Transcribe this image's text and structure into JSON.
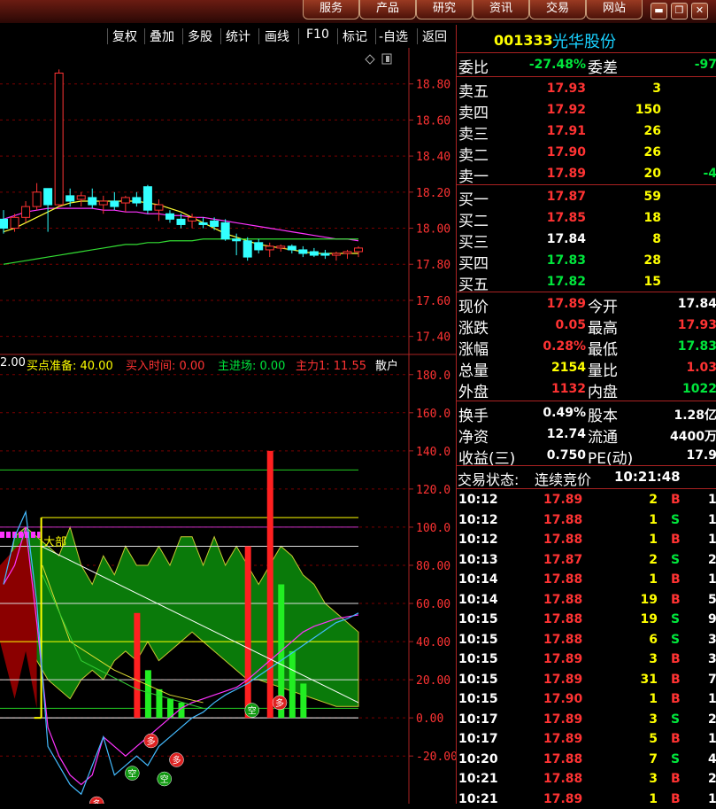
{
  "nav": {
    "buttons": [
      "服务",
      "产品",
      "研究",
      "资讯",
      "交易",
      "网站"
    ],
    "window_buttons": {
      "minimize": "▬",
      "restore": "❐",
      "close": "✕"
    }
  },
  "toolbar": {
    "items": [
      "复权",
      "叠加",
      "多股",
      "统计",
      "画线",
      "F10",
      "标记",
      "-自选",
      "返回"
    ]
  },
  "stock": {
    "code": "001333",
    "name": "光华股份"
  },
  "order_ratio": {
    "label1": "委比",
    "value1": "-27.48%",
    "label2": "委差",
    "value2": "-97"
  },
  "asks": [
    {
      "label": "卖五",
      "price": "17.93",
      "vol": "3",
      "extra": ""
    },
    {
      "label": "卖四",
      "price": "17.92",
      "vol": "150",
      "extra": ""
    },
    {
      "label": "卖三",
      "price": "17.91",
      "vol": "26",
      "extra": ""
    },
    {
      "label": "卖二",
      "price": "17.90",
      "vol": "26",
      "extra": ""
    },
    {
      "label": "卖一",
      "price": "17.89",
      "vol": "20",
      "extra": "-4"
    }
  ],
  "bids": [
    {
      "label": "买一",
      "price": "17.87",
      "vol": "59"
    },
    {
      "label": "买二",
      "price": "17.85",
      "vol": "18"
    },
    {
      "label": "买三",
      "price": "17.84",
      "vol": "8"
    },
    {
      "label": "买四",
      "price": "17.83",
      "vol": "28"
    },
    {
      "label": "买五",
      "price": "17.82",
      "vol": "15"
    }
  ],
  "quote_rows": [
    {
      "l1": "现价",
      "v1": "17.89",
      "l2": "今开",
      "v2": "17.84"
    },
    {
      "l1": "涨跌",
      "v1": "0.05",
      "l2": "最高",
      "v2": "17.93"
    },
    {
      "l1": "涨幅",
      "v1": "0.28%",
      "l2": "最低",
      "v2": "17.83"
    },
    {
      "l1": "总量",
      "v1": "2154",
      "l2": "量比",
      "v2": "1.03"
    },
    {
      "l1": "外盘",
      "v1": "1132",
      "l2": "内盘",
      "v2": "1022"
    }
  ],
  "stats_rows": [
    {
      "l1": "换手",
      "v1": "0.49%",
      "l2": "股本",
      "v2": "1.28亿"
    },
    {
      "l1": "净资",
      "v1": "12.74",
      "l2": "流通",
      "v2": "4400万"
    },
    {
      "l1": "收益(三)",
      "v1": "0.750",
      "l2": "PE(动)",
      "v2": "17.9"
    }
  ],
  "trade_status": {
    "label": "交易状态:",
    "state": "连续竞价",
    "time": "10:21:48"
  },
  "ticks": [
    {
      "time": "10:12",
      "price": "17.89",
      "vol": "2",
      "side": "B",
      "n": "1"
    },
    {
      "time": "10:12",
      "price": "17.88",
      "vol": "1",
      "side": "S",
      "n": "1"
    },
    {
      "time": "10:12",
      "price": "17.88",
      "vol": "1",
      "side": "B",
      "n": "1"
    },
    {
      "time": "10:13",
      "price": "17.87",
      "vol": "2",
      "side": "S",
      "n": "2"
    },
    {
      "time": "10:14",
      "price": "17.88",
      "vol": "1",
      "side": "B",
      "n": "1"
    },
    {
      "time": "10:14",
      "price": "17.88",
      "vol": "19",
      "side": "B",
      "n": "5"
    },
    {
      "time": "10:15",
      "price": "17.88",
      "vol": "19",
      "side": "S",
      "n": "9"
    },
    {
      "time": "10:15",
      "price": "17.88",
      "vol": "6",
      "side": "S",
      "n": "3"
    },
    {
      "time": "10:15",
      "price": "17.89",
      "vol": "3",
      "side": "B",
      "n": "3"
    },
    {
      "time": "10:15",
      "price": "17.89",
      "vol": "31",
      "side": "B",
      "n": "7"
    },
    {
      "time": "10:15",
      "price": "17.90",
      "vol": "1",
      "side": "B",
      "n": "1"
    },
    {
      "time": "10:17",
      "price": "17.89",
      "vol": "3",
      "side": "S",
      "n": "2"
    },
    {
      "time": "10:17",
      "price": "17.89",
      "vol": "5",
      "side": "B",
      "n": "1"
    },
    {
      "time": "10:20",
      "price": "17.88",
      "vol": "7",
      "side": "S",
      "n": "4"
    },
    {
      "time": "10:21",
      "price": "17.88",
      "vol": "3",
      "side": "B",
      "n": "2"
    },
    {
      "time": "10:21",
      "price": "17.89",
      "vol": "1",
      "side": "B",
      "n": "1"
    }
  ],
  "indicator": {
    "prefix": "2.00",
    "items": [
      {
        "label": "买点准备: 40.00",
        "color": "#ffff00"
      },
      {
        "label": "买入时间: 0.00",
        "color": "#ff3333"
      },
      {
        "label": "主进场: 0.00",
        "color": "#00e63c"
      },
      {
        "label": "主力1: 11.55",
        "color": "#ff3333"
      },
      {
        "label": "散户",
        "color": "#ffffff"
      }
    ],
    "annotation_top": "大部",
    "markers": {
      "duo": "多",
      "kong": "空"
    }
  },
  "price_axis": [
    "18.80",
    "18.60",
    "18.40",
    "18.20",
    "18.00",
    "17.80",
    "17.60",
    "17.40"
  ],
  "ind_axis": [
    "180.0",
    "160.0",
    "140.0",
    "120.0",
    "100.0",
    "80.00",
    "60.00",
    "40.00",
    "20.00",
    "0.00",
    "-20.00"
  ],
  "chart_data": {
    "type": "candlestick+indicator",
    "price_ylim": [
      17.3,
      19.0
    ],
    "indicator_ylim": [
      -45,
      185
    ],
    "ohlc": [
      {
        "o": 18.05,
        "h": 18.1,
        "l": 17.97,
        "c": 18.0
      },
      {
        "o": 18.0,
        "h": 18.08,
        "l": 17.98,
        "c": 18.06
      },
      {
        "o": 18.06,
        "h": 18.15,
        "l": 18.03,
        "c": 18.12
      },
      {
        "o": 18.12,
        "h": 18.25,
        "l": 18.1,
        "c": 18.2
      },
      {
        "o": 18.22,
        "h": 18.22,
        "l": 17.98,
        "c": 18.13
      },
      {
        "o": 18.13,
        "h": 18.88,
        "l": 18.12,
        "c": 18.86
      },
      {
        "o": 18.18,
        "h": 18.22,
        "l": 18.12,
        "c": 18.15
      },
      {
        "o": 18.16,
        "h": 18.2,
        "l": 18.12,
        "c": 18.18
      },
      {
        "o": 18.17,
        "h": 18.22,
        "l": 18.11,
        "c": 18.13
      },
      {
        "o": 18.13,
        "h": 18.18,
        "l": 18.08,
        "c": 18.15
      },
      {
        "o": 18.15,
        "h": 18.2,
        "l": 18.1,
        "c": 18.12
      },
      {
        "o": 18.14,
        "h": 18.18,
        "l": 18.09,
        "c": 18.17
      },
      {
        "o": 18.17,
        "h": 18.2,
        "l": 18.12,
        "c": 18.14
      },
      {
        "o": 18.23,
        "h": 18.24,
        "l": 18.08,
        "c": 18.1
      },
      {
        "o": 18.1,
        "h": 18.16,
        "l": 18.04,
        "c": 18.13
      },
      {
        "o": 18.08,
        "h": 18.1,
        "l": 18.03,
        "c": 18.05
      },
      {
        "o": 18.05,
        "h": 18.08,
        "l": 18.0,
        "c": 18.02
      },
      {
        "o": 18.04,
        "h": 18.08,
        "l": 18.0,
        "c": 18.06
      },
      {
        "o": 18.03,
        "h": 18.06,
        "l": 18.0,
        "c": 18.02
      },
      {
        "o": 18.04,
        "h": 18.06,
        "l": 17.99,
        "c": 18.01
      },
      {
        "o": 18.03,
        "h": 18.05,
        "l": 17.93,
        "c": 17.94
      },
      {
        "o": 17.94,
        "h": 17.97,
        "l": 17.85,
        "c": 17.93
      },
      {
        "o": 17.93,
        "h": 17.95,
        "l": 17.82,
        "c": 17.84
      },
      {
        "o": 17.92,
        "h": 17.94,
        "l": 17.86,
        "c": 17.88
      },
      {
        "o": 17.88,
        "h": 17.92,
        "l": 17.84,
        "c": 17.9
      },
      {
        "o": 17.89,
        "h": 17.91,
        "l": 17.87,
        "c": 17.9
      },
      {
        "o": 17.9,
        "h": 17.91,
        "l": 17.86,
        "c": 17.88
      },
      {
        "o": 17.88,
        "h": 17.9,
        "l": 17.84,
        "c": 17.86
      },
      {
        "o": 17.87,
        "h": 17.89,
        "l": 17.84,
        "c": 17.85
      },
      {
        "o": 17.86,
        "h": 17.88,
        "l": 17.83,
        "c": 17.85
      },
      {
        "o": 17.85,
        "h": 17.87,
        "l": 17.82,
        "c": 17.86
      },
      {
        "o": 17.86,
        "h": 17.88,
        "l": 17.83,
        "c": 17.87
      },
      {
        "o": 17.87,
        "h": 17.9,
        "l": 17.84,
        "c": 17.89
      }
    ],
    "ma_magenta": [
      18.05,
      18.07,
      18.09,
      18.1,
      18.11,
      18.11,
      18.11,
      18.11,
      18.11,
      18.1,
      18.1,
      18.09,
      18.09,
      18.08,
      18.08,
      18.07,
      18.07,
      18.06,
      18.06,
      18.05,
      18.04,
      18.03,
      18.02,
      18.01,
      18.0,
      17.99,
      17.98,
      17.97,
      17.96,
      17.95,
      17.94,
      17.94,
      17.93
    ],
    "ma_yellow": [
      17.98,
      18.0,
      18.03,
      18.06,
      18.09,
      18.12,
      18.14,
      18.15,
      18.15,
      18.15,
      18.15,
      18.15,
      18.15,
      18.14,
      18.13,
      18.11,
      18.09,
      18.06,
      18.03,
      18.0,
      17.97,
      17.95,
      17.93,
      17.91,
      17.9,
      17.89,
      17.88,
      17.87,
      17.86,
      17.86,
      17.86,
      17.86,
      17.86
    ],
    "ma_green": [
      17.8,
      17.81,
      17.82,
      17.83,
      17.84,
      17.85,
      17.86,
      17.87,
      17.88,
      17.89,
      17.9,
      17.91,
      17.91,
      17.92,
      17.92,
      17.93,
      17.93,
      17.93,
      17.94,
      17.94,
      17.94,
      17.94,
      17.94,
      17.94,
      17.94,
      17.94,
      17.94,
      17.94,
      17.94,
      17.94,
      17.94,
      17.94,
      17.94
    ],
    "ind_hlines": [
      130,
      105,
      100,
      90,
      60,
      40,
      20,
      5,
      0
    ],
    "green_band_upper": [
      60,
      95,
      100,
      95,
      90,
      85,
      100,
      80,
      70,
      85,
      75,
      90,
      80,
      80,
      90,
      80,
      95,
      95,
      80,
      95,
      80,
      90,
      80,
      70,
      80,
      90,
      85,
      75,
      70,
      60,
      55,
      50,
      45
    ],
    "green_band_lower": [
      60,
      55,
      45,
      30,
      20,
      15,
      10,
      20,
      25,
      20,
      30,
      35,
      30,
      40,
      30,
      35,
      40,
      45,
      40,
      35,
      30,
      25,
      20,
      20,
      18,
      16,
      14,
      12,
      10,
      8,
      6,
      6,
      6
    ],
    "cyan_line": [
      70,
      95,
      108,
      60,
      -15,
      -25,
      -35,
      -40,
      -25,
      -10,
      -30,
      -25,
      -20,
      -25,
      -15,
      -10,
      -5,
      0,
      3,
      8,
      12,
      15,
      18,
      22,
      26,
      30,
      34,
      38,
      42,
      46,
      50,
      52,
      55
    ],
    "magenta_line": [
      70,
      80,
      100,
      50,
      -5,
      -20,
      -30,
      -35,
      -30,
      -10,
      -15,
      -20,
      -15,
      -10,
      -5,
      0,
      5,
      8,
      10,
      12,
      14,
      16,
      20,
      25,
      30,
      35,
      40,
      45,
      48,
      50,
      52,
      53,
      54
    ],
    "red_bars": [
      {
        "i": 12,
        "v": 55
      },
      {
        "i": 22,
        "v": 90
      },
      {
        "i": 24,
        "v": 140
      }
    ],
    "green_bars": [
      {
        "i": 13,
        "v": 25
      },
      {
        "i": 14,
        "v": 15
      },
      {
        "i": 15,
        "v": 10
      },
      {
        "i": 16,
        "v": 8
      },
      {
        "i": 25,
        "v": 70
      },
      {
        "i": 26,
        "v": 35
      },
      {
        "i": 27,
        "v": 18
      }
    ]
  }
}
